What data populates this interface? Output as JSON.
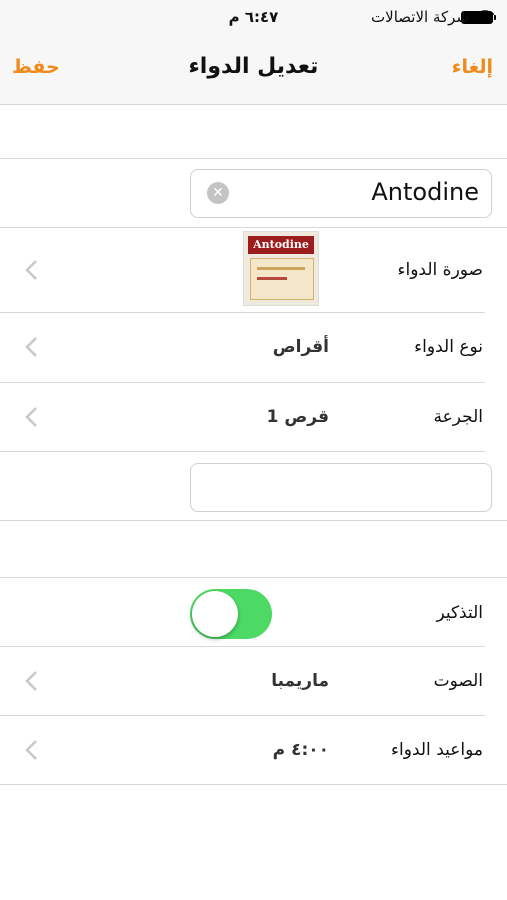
{
  "status_bar": {
    "carrier": "شركة الاتصالات",
    "time": "٦:٤٧ م",
    "wifi_icon": "wifi-icon",
    "battery_icon": "battery-icon"
  },
  "nav": {
    "title": "تعديل الدواء",
    "save_label": "حفظ",
    "cancel_label": "إلغاء",
    "accent_color": "#f08a1d"
  },
  "medicine": {
    "name_value": "Antodine",
    "clear_icon": "clear-icon",
    "notes_value": ""
  },
  "rows": {
    "image_label": "صورة الدواء",
    "type_label": "نوع الدواء",
    "type_value": "أقراص",
    "dose_label": "الجرعة",
    "dose_value": "1 قرص",
    "reminder_label": "التذكير",
    "reminder_on": true,
    "sound_label": "الصوت",
    "sound_value": "ماريمبا",
    "schedule_label": "مواعيد الدواء",
    "schedule_value": "٤:٠٠ م"
  },
  "thumbnail": {
    "brand_text": "Antodine"
  },
  "colors": {
    "toggle_on": "#4cd964"
  }
}
